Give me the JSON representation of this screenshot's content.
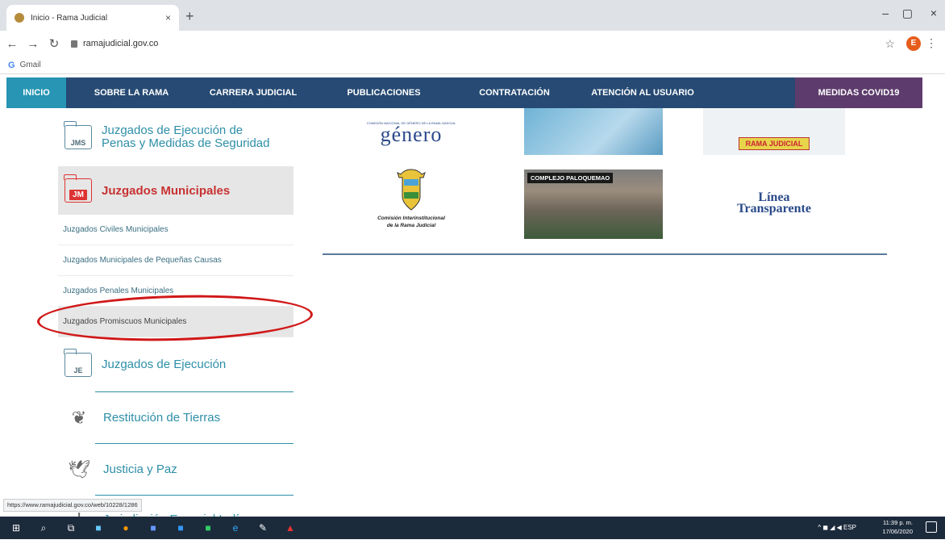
{
  "browser": {
    "tab_title": "Inicio - Rama Judicial",
    "tab_close": "×",
    "new_tab": "+",
    "url": "ramajudicial.gov.co",
    "profile_initial": "E",
    "bookmark": "Gmail",
    "window_controls": [
      "–",
      "▢",
      "×"
    ],
    "status_url": "https://www.ramajudicial.gov.co/web/10228/1286"
  },
  "nav": {
    "items": [
      "INICIO",
      "SOBRE LA RAMA",
      "CARRERA JUDICIAL",
      "PUBLICACIONES",
      "CONTRATACIÓN",
      "ATENCIÓN AL USUARIO",
      "MEDIDAS COVID19"
    ]
  },
  "sidebar": {
    "ejecucion_penas": {
      "icon_label": "JMS",
      "label_line1": "Juzgados de Ejecución de",
      "label_line2": "Penas y Medidas de Seguridad"
    },
    "municipales": {
      "icon_label": "JM",
      "label": "Juzgados Municipales"
    },
    "sub_items": [
      "Juzgados Civiles Municipales",
      "Juzgados Municipales de Pequeñas Causas",
      "Juzgados Penales Municipales",
      "Juzgados Promiscuos Municipales"
    ],
    "ejecucion": {
      "icon_label": "JE",
      "label": "Juzgados de Ejecución"
    },
    "restitucion": {
      "label": "Restitución de Tierras"
    },
    "justicia_paz": {
      "label": "Justicia y Paz"
    },
    "indigena": {
      "label": "Jurisdicción Especial Indígena"
    }
  },
  "content": {
    "genero_text": "género",
    "genero_small": "COMISIÓN NACIONAL DE GÉNERO DE LA RAMA JUDICIAL",
    "kids_banner": "RAMA JUDICIAL",
    "escudo_caption_line1": "Comisión Interinstitucional",
    "escudo_caption_line2": "de la Rama Judicial",
    "paloquemao_label": "COMPLEJO PALOQUEMAO",
    "linea_line1": "Línea",
    "linea_line2": "Transparente"
  },
  "taskbar": {
    "time": "11:39 p. m.",
    "date": "17/06/2020",
    "lang": "ESP"
  },
  "colors": {
    "nav_bg": "#264a73",
    "nav_inicio": "#2795b3",
    "nav_covid": "#5d3b6c",
    "accent_teal": "#2e8fa8",
    "active_red": "#c83232",
    "annotation_red": "#d01818"
  }
}
